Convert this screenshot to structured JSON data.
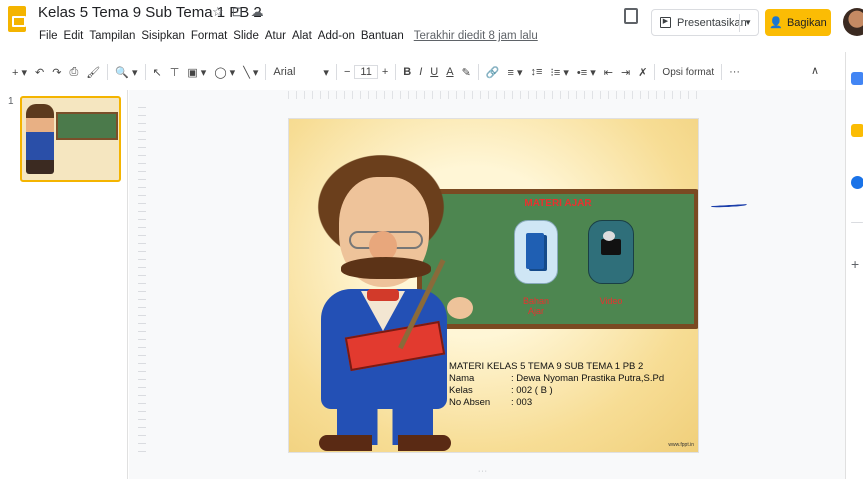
{
  "document": {
    "title": "Kelas 5 Tema 9 Sub Tema 1 PB 2",
    "last_edit": "Terakhir diedit 8 jam lalu"
  },
  "title_icons": [
    "☆",
    "⊡",
    "☁"
  ],
  "menu": [
    "File",
    "Edit",
    "Tampilan",
    "Sisipkan",
    "Format",
    "Slide",
    "Atur",
    "Alat",
    "Add-on",
    "Bantuan"
  ],
  "header": {
    "present_label": "Presentasikan",
    "share_label": "Bagikan"
  },
  "toolbar": {
    "font": "Arial",
    "font_size": "11",
    "format_options": "Opsi format",
    "more": "···"
  },
  "filmstrip": {
    "slide_number": "1"
  },
  "slide": {
    "board_title": "MATERI AJAR",
    "link_book": "Bahan Ajar",
    "link_video": "Video",
    "info_title": "MATERI KELAS 5 TEMA 9 SUB TEMA 1 PB 2",
    "rows": [
      {
        "key": "Nama",
        "value": ": Dewa Nyoman Prastika Putra,S.Pd"
      },
      {
        "key": "Kelas",
        "value": ": 002 ( B )"
      },
      {
        "key": "No Absen",
        "value": ": 003"
      }
    ],
    "watermark": "www.fppt.in"
  },
  "colors": {
    "accent_yellow": "#fbbc04",
    "slide_red_text": "#e8312f",
    "board_green": "#4d8650"
  }
}
